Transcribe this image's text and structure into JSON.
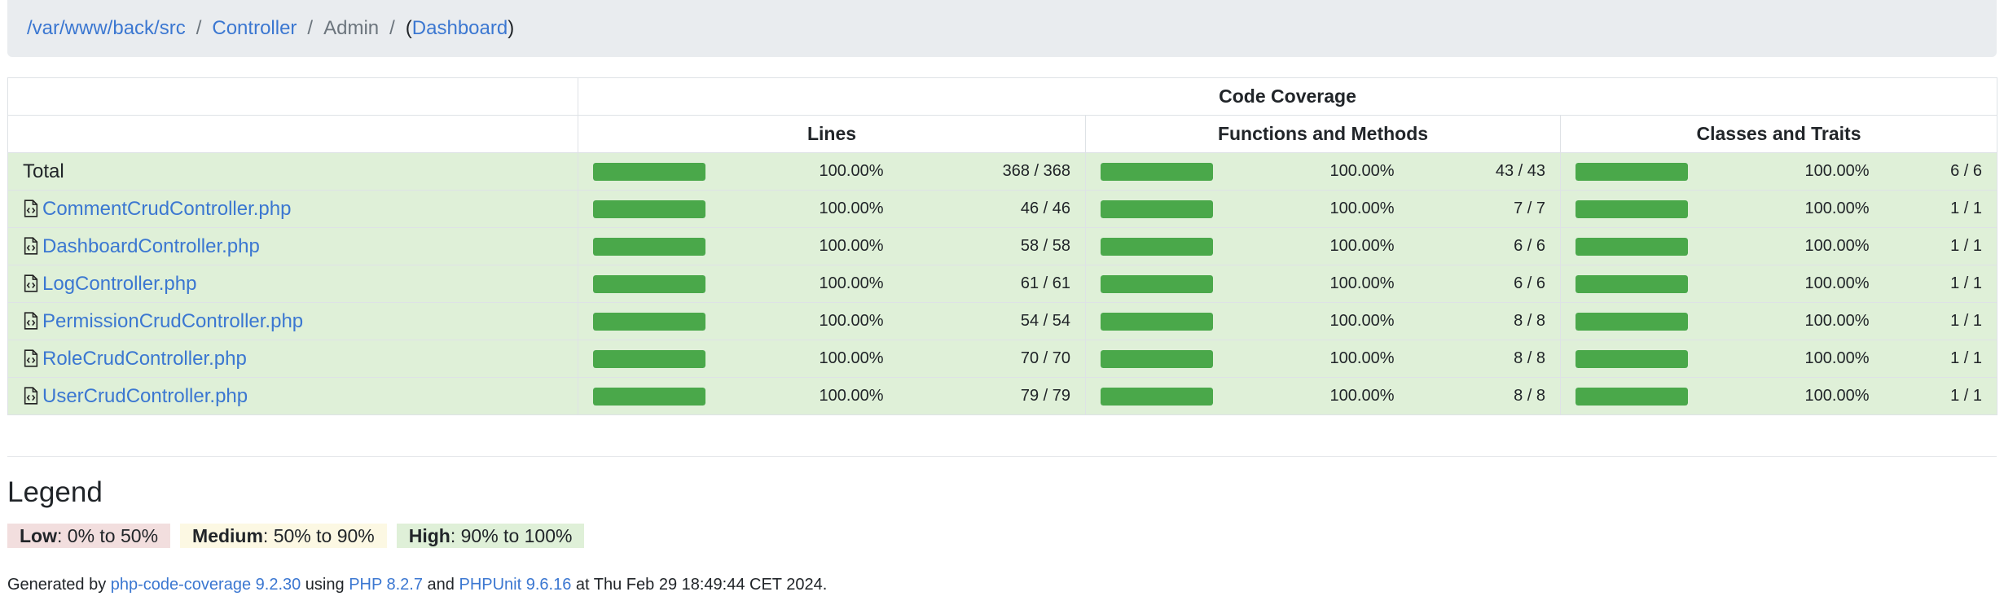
{
  "breadcrumb": {
    "root": "/var/www/back/src",
    "controller": "Controller",
    "admin": "Admin",
    "dashboard": "Dashboard",
    "separator": "/"
  },
  "table": {
    "header_title": "Code Coverage",
    "col_lines": "Lines",
    "col_functions": "Functions and Methods",
    "col_classes": "Classes and Traits",
    "rows": [
      {
        "name": "Total",
        "link": false,
        "lines_pct": "100.00%",
        "lines_cnt": "368 / 368",
        "lines_ratio": 1.0,
        "func_pct": "100.00%",
        "func_cnt": "43 / 43",
        "func_ratio": 1.0,
        "cls_pct": "100.00%",
        "cls_cnt": "6 / 6",
        "cls_ratio": 1.0
      },
      {
        "name": "CommentCrudController.php",
        "link": true,
        "lines_pct": "100.00%",
        "lines_cnt": "46 / 46",
        "lines_ratio": 1.0,
        "func_pct": "100.00%",
        "func_cnt": "7 / 7",
        "func_ratio": 1.0,
        "cls_pct": "100.00%",
        "cls_cnt": "1 / 1",
        "cls_ratio": 1.0
      },
      {
        "name": "DashboardController.php",
        "link": true,
        "lines_pct": "100.00%",
        "lines_cnt": "58 / 58",
        "lines_ratio": 1.0,
        "func_pct": "100.00%",
        "func_cnt": "6 / 6",
        "func_ratio": 1.0,
        "cls_pct": "100.00%",
        "cls_cnt": "1 / 1",
        "cls_ratio": 1.0
      },
      {
        "name": "LogController.php",
        "link": true,
        "lines_pct": "100.00%",
        "lines_cnt": "61 / 61",
        "lines_ratio": 1.0,
        "func_pct": "100.00%",
        "func_cnt": "6 / 6",
        "func_ratio": 1.0,
        "cls_pct": "100.00%",
        "cls_cnt": "1 / 1",
        "cls_ratio": 1.0
      },
      {
        "name": "PermissionCrudController.php",
        "link": true,
        "lines_pct": "100.00%",
        "lines_cnt": "54 / 54",
        "lines_ratio": 1.0,
        "func_pct": "100.00%",
        "func_cnt": "8 / 8",
        "func_ratio": 1.0,
        "cls_pct": "100.00%",
        "cls_cnt": "1 / 1",
        "cls_ratio": 1.0
      },
      {
        "name": "RoleCrudController.php",
        "link": true,
        "lines_pct": "100.00%",
        "lines_cnt": "70 / 70",
        "lines_ratio": 1.0,
        "func_pct": "100.00%",
        "func_cnt": "8 / 8",
        "func_ratio": 1.0,
        "cls_pct": "100.00%",
        "cls_cnt": "1 / 1",
        "cls_ratio": 1.0
      },
      {
        "name": "UserCrudController.php",
        "link": true,
        "lines_pct": "100.00%",
        "lines_cnt": "79 / 79",
        "lines_ratio": 1.0,
        "func_pct": "100.00%",
        "func_cnt": "8 / 8",
        "func_ratio": 1.0,
        "cls_pct": "100.00%",
        "cls_cnt": "1 / 1",
        "cls_ratio": 1.0
      }
    ]
  },
  "legend": {
    "title": "Legend",
    "low_label": "Low",
    "low_range": ": 0% to 50%",
    "medium_label": "Medium",
    "medium_range": ": 50% to 90%",
    "high_label": "High",
    "high_range": ": 90% to 100%"
  },
  "footer": {
    "prefix": "Generated by ",
    "tool_link": "php-code-coverage 9.2.30",
    "using": " using ",
    "php_link": "PHP 8.2.7",
    "and": " and ",
    "phpunit_link": "PHPUnit 9.6.16",
    "suffix": " at Thu Feb 29 18:49:44 CET 2024."
  },
  "colors": {
    "bar_fill": "#4aa84a",
    "row_success": "#dff0d8",
    "link": "#3b77d1"
  },
  "icons": {
    "file": "file-code-icon"
  }
}
